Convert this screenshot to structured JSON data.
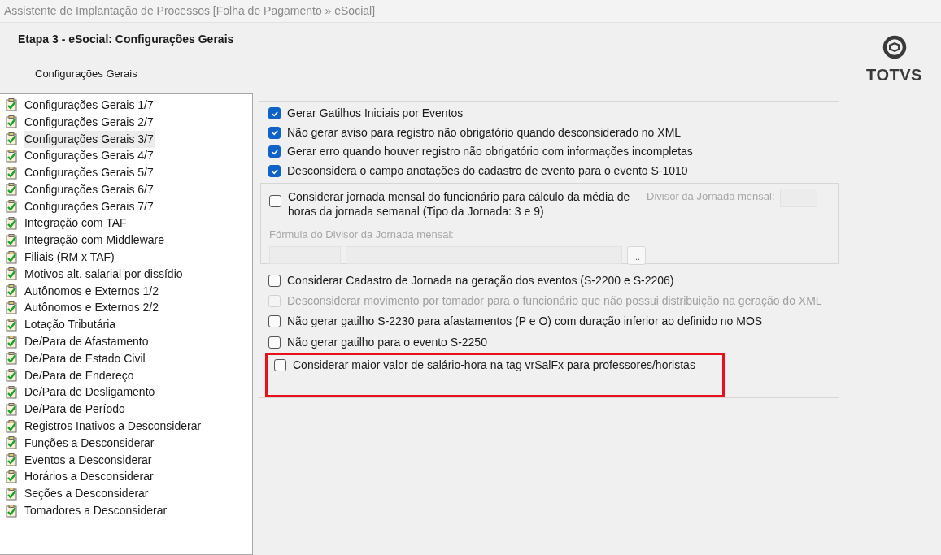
{
  "window": {
    "title": "Assistente de Implantação de Processos [Folha de Pagamento » eSocial]"
  },
  "header": {
    "title": "Etapa 3 - eSocial: Configurações Gerais",
    "subtitle": "Configurações Gerais",
    "logo_text": "TOTVS"
  },
  "steps": [
    {
      "label": "Configurações Gerais 1/7",
      "selected": false
    },
    {
      "label": "Configurações Gerais 2/7",
      "selected": false
    },
    {
      "label": "Configurações Gerais 3/7",
      "selected": true
    },
    {
      "label": "Configurações Gerais 4/7",
      "selected": false
    },
    {
      "label": "Configurações Gerais 5/7",
      "selected": false
    },
    {
      "label": "Configurações Gerais 6/7",
      "selected": false
    },
    {
      "label": "Configurações Gerais 7/7",
      "selected": false
    },
    {
      "label": "Integração com TAF",
      "selected": false
    },
    {
      "label": "Integração com Middleware",
      "selected": false
    },
    {
      "label": "Filiais (RM x TAF)",
      "selected": false
    },
    {
      "label": "Motivos alt. salarial por dissídio",
      "selected": false
    },
    {
      "label": "Autônomos e Externos 1/2",
      "selected": false
    },
    {
      "label": "Autônomos e Externos 2/2",
      "selected": false
    },
    {
      "label": "Lotação Tributária",
      "selected": false
    },
    {
      "label": "De/Para de Afastamento",
      "selected": false
    },
    {
      "label": "De/Para de Estado Civil",
      "selected": false
    },
    {
      "label": "De/Para de Endereço",
      "selected": false
    },
    {
      "label": "De/Para de Desligamento",
      "selected": false
    },
    {
      "label": "De/Para de Período",
      "selected": false
    },
    {
      "label": "Registros Inativos a Desconsiderar",
      "selected": false
    },
    {
      "label": "Funções a Desconsiderar",
      "selected": false
    },
    {
      "label": "Eventos a Desconsiderar",
      "selected": false
    },
    {
      "label": "Horários a Desconsiderar",
      "selected": false
    },
    {
      "label": "Seções a Desconsiderar",
      "selected": false
    },
    {
      "label": "Tomadores a Desconsiderar",
      "selected": false
    }
  ],
  "options_top": [
    {
      "label": "Gerar Gatilhos Iniciais por Eventos",
      "checked": true,
      "disabled": false
    },
    {
      "label": "Não gerar aviso para registro não obrigatório quando desconsiderado no XML",
      "checked": true,
      "disabled": false
    },
    {
      "label": "Gerar erro quando houver registro não obrigatório com informações incompletas",
      "checked": true,
      "disabled": false
    },
    {
      "label": "Desconsidera o campo anotações do cadastro de evento para o evento S-1010",
      "checked": true,
      "disabled": false
    }
  ],
  "jornada_group": {
    "option": {
      "label": "Considerar jornada mensal do funcionário para cálculo da média de horas da jornada semanal (Tipo da Jornada: 3 e 9)",
      "checked": false
    },
    "divisor_label": "Divisor da Jornada mensal:",
    "formula_label": "Fórmula do Divisor da Jornada mensal:",
    "browse_button": "..."
  },
  "options_bottom": [
    {
      "label": "Considerar Cadastro de Jornada na geração dos eventos (S-2200 e S-2206)",
      "checked": false,
      "disabled": false
    },
    {
      "label": "Desconsiderar movimento por tomador para o funcionário que não possui distribuição na geração do XML",
      "checked": false,
      "disabled": true
    },
    {
      "label": "Não gerar gatilho S-2230 para afastamentos (P e O) com duração inferior ao definido no MOS",
      "checked": false,
      "disabled": false
    },
    {
      "label": "Não gerar gatilho para o evento S-2250",
      "checked": false,
      "disabled": false
    }
  ],
  "highlighted_option": {
    "label": "Considerar maior valor de salário-hora na tag vrSalFx para professores/horistas",
    "checked": false
  }
}
